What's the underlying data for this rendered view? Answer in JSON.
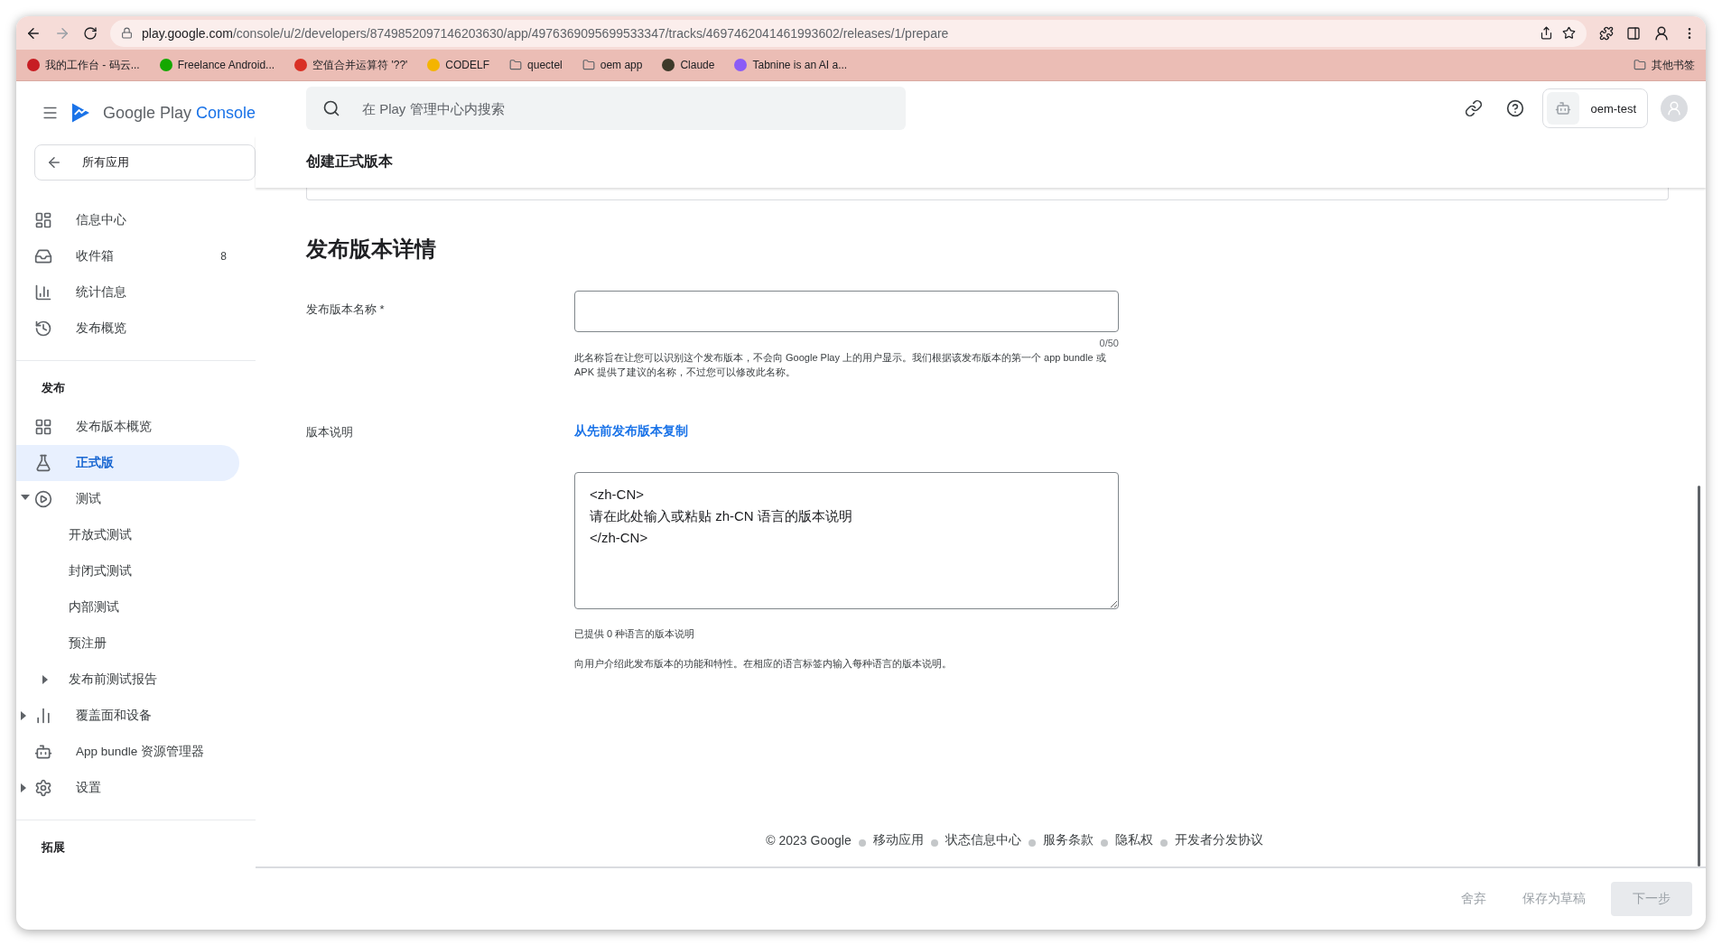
{
  "browser": {
    "url": {
      "host": "play.google.com",
      "path": "/console/u/2/developers/8749852097146203630/app/4976369095699533347/tracks/4697462041461993602/releases/1/prepare"
    },
    "bookmarks": [
      {
        "label": "我的工作台 - 码云...",
        "kind": "site",
        "color": "#c71d23"
      },
      {
        "label": "Freelance Android...",
        "kind": "site",
        "color": "#14a800"
      },
      {
        "label": "空值合并运算符 '??'",
        "kind": "site",
        "color": "#d93025"
      },
      {
        "label": "CODELF",
        "kind": "site",
        "color": "#f4b400"
      },
      {
        "label": "quectel",
        "kind": "folder"
      },
      {
        "label": "oem app",
        "kind": "folder"
      },
      {
        "label": "Claude",
        "kind": "site",
        "color": "#3d3929"
      },
      {
        "label": "Tabnine is an AI a...",
        "kind": "site",
        "color": "#8b5cf6"
      }
    ],
    "other_bookmarks": "其他书签"
  },
  "app": {
    "logo": {
      "brand": "Google Play",
      "product": "Console"
    },
    "search": {
      "placeholder": "在 Play 管理中心内搜索"
    },
    "account": "oem-test"
  },
  "sidebar": {
    "back": "所有应用",
    "top_items": [
      {
        "label": "信息中心",
        "selected": false
      },
      {
        "label": "收件箱",
        "badge": "8",
        "selected": false
      },
      {
        "label": "统计信息",
        "selected": false
      },
      {
        "label": "发布概览",
        "selected": false
      }
    ],
    "sections": [
      {
        "title": "发布",
        "items": [
          {
            "label": "发布版本概览",
            "selected": false
          },
          {
            "label": "正式版",
            "selected": true
          },
          {
            "label": "测试",
            "selected": false,
            "expanded": true,
            "children": [
              {
                "label": "开放式测试",
                "selected": false
              },
              {
                "label": "封闭式测试",
                "selected": false
              },
              {
                "label": "内部测试",
                "selected": false
              },
              {
                "label": "预注册",
                "selected": false
              },
              {
                "label": "发布前测试报告",
                "selected": false,
                "expanded": false
              }
            ]
          },
          {
            "label": "覆盖面和设备",
            "selected": false,
            "expanded": false
          },
          {
            "label": "App bundle 资源管理器",
            "selected": false
          },
          {
            "label": "设置",
            "selected": false,
            "expanded": false
          }
        ]
      },
      {
        "title": "拓展"
      }
    ]
  },
  "page": {
    "title": "创建正式版本",
    "heading": "发布版本详情",
    "name_field": {
      "label": "发布版本名称 *",
      "counter": "0/50",
      "help": "此名称旨在让您可以识别这个发布版本，不会向 Google Play 上的用户显示。我们根据该发布版本的第一个 app bundle 或 APK 提供了建议的名称，不过您可以修改此名称。"
    },
    "notes_field": {
      "label": "版本说明",
      "copy_link": "从先前发布版本复制",
      "value": "<zh-CN>\n请在此处输入或粘贴 zh-CN 语言的版本说明\n</zh-CN>",
      "count": "已提供 0 种语言的版本说明",
      "help": "向用户介绍此发布版本的功能和特性。在相应的语言标签内输入每种语言的版本说明。"
    }
  },
  "footer": {
    "copyright": "© 2023 Google",
    "links": [
      "移动应用",
      "状态信息中心",
      "服务条款",
      "隐私权",
      "开发者分发协议"
    ]
  },
  "actions": [
    {
      "label": "舍弃",
      "kind": "text",
      "disabled": true
    },
    {
      "label": "保存为草稿",
      "kind": "text",
      "disabled": true
    },
    {
      "label": "下一步",
      "kind": "filled",
      "disabled": true
    }
  ]
}
